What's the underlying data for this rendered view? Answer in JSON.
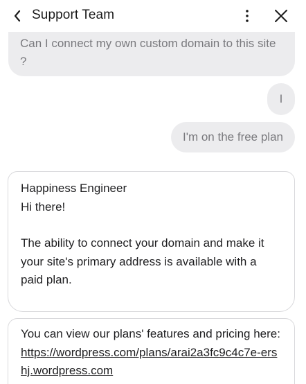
{
  "header": {
    "title": "Support Team",
    "icons": {
      "back": "chevron-left-icon",
      "more": "vertical-dots-icon",
      "close": "close-icon"
    }
  },
  "messages": [
    {
      "side": "user",
      "text": "Can I connect my own custom domain to this site ?"
    },
    {
      "side": "user",
      "text": "I"
    },
    {
      "side": "user",
      "text": "I'm on the free plan"
    }
  ],
  "agent": {
    "sender": "Happiness Engineer",
    "greeting": "Hi there!",
    "body": "The ability to connect your domain and make it your site's primary address is available with a paid plan.",
    "plans_text": "You can view our plans' features and pricing here:",
    "plans_link": "https://wordpress.com/plans/arai2a3fc9c4c7e-ershj.wordpress.com"
  },
  "colors": {
    "user_bubble_bg": "#ececee",
    "user_bubble_text": "#7a7a7e",
    "card_border": "#d9d9dc",
    "text": "#1f1f21"
  }
}
